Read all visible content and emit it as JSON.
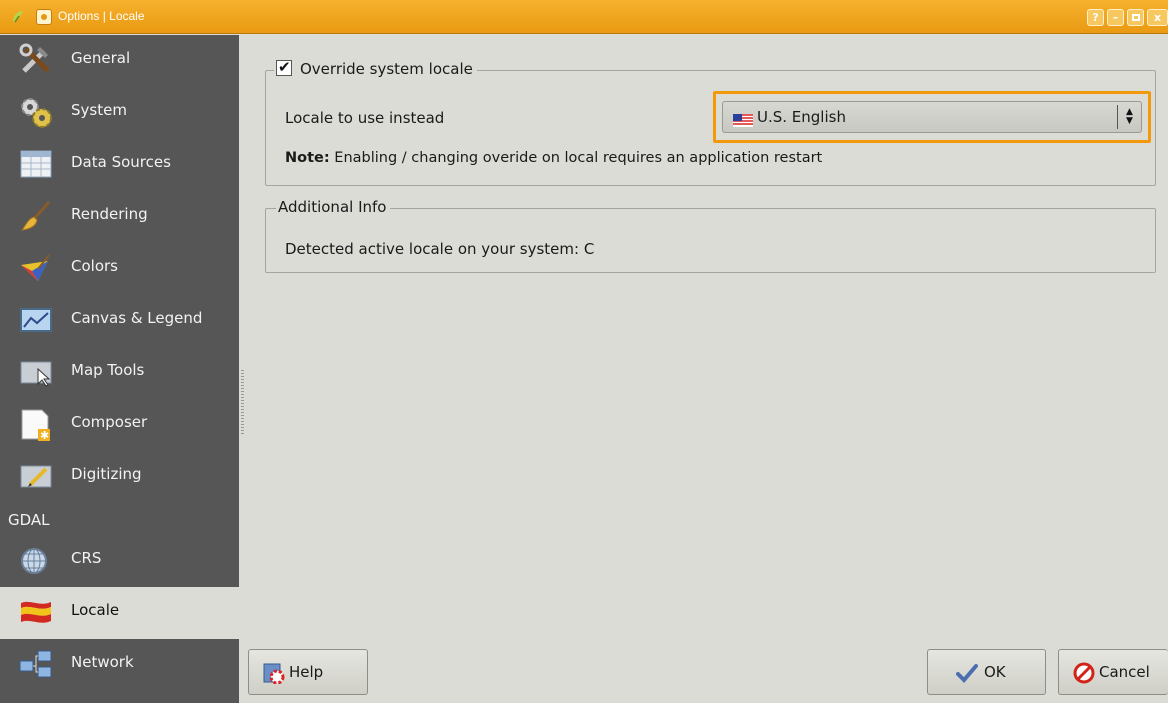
{
  "window": {
    "title": "Options | Locale",
    "buttons": [
      "?",
      "–",
      "□",
      "x"
    ]
  },
  "sidebar": {
    "items": [
      {
        "label": "General",
        "icon": "tools-icon"
      },
      {
        "label": "System",
        "icon": "gears-icon"
      },
      {
        "label": "Data Sources",
        "icon": "table-icon"
      },
      {
        "label": "Rendering",
        "icon": "brush-icon"
      },
      {
        "label": "Colors",
        "icon": "palette-icon"
      },
      {
        "label": "Canvas & Legend",
        "icon": "canvas-icon"
      },
      {
        "label": "Map Tools",
        "icon": "map-tools-icon"
      },
      {
        "label": "Composer",
        "icon": "composer-icon"
      },
      {
        "label": "Digitizing",
        "icon": "digitizing-icon"
      },
      {
        "label": "CRS",
        "icon": "globe-icon"
      },
      {
        "label": "Locale",
        "icon": "locale-flag-icon"
      },
      {
        "label": "Network",
        "icon": "network-icon"
      }
    ],
    "heading": "GDAL",
    "active": "Locale"
  },
  "override_group": {
    "checkbox_label": "Override system locale",
    "checked": true,
    "locale_label": "Locale to use instead",
    "locale_value": "U.S. English",
    "note_bold": "Note:",
    "note_text": " Enabling / changing overide on local requires an application restart"
  },
  "info_group": {
    "title": "Additional Info",
    "detected_text": "Detected active locale on your system: C"
  },
  "footer": {
    "help_label": "Help",
    "ok_label": "OK",
    "cancel_label": "Cancel"
  },
  "colors": {
    "titlebar": "#eea31f",
    "highlight": "#f29a0c",
    "sidebar": "#565656",
    "panel": "#dcdcd6"
  }
}
